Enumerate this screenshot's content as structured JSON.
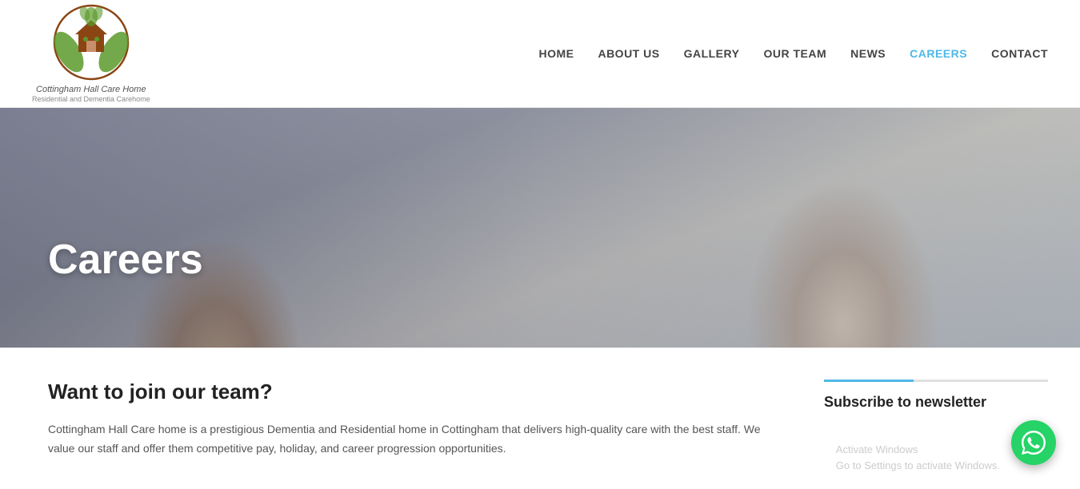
{
  "header": {
    "logo_main": "Cottingham Hall Care Home",
    "logo_sub": "Residential and Dementia Carehome",
    "nav": [
      {
        "label": "HOME",
        "active": false,
        "id": "home"
      },
      {
        "label": "ABOUT US",
        "active": false,
        "id": "about-us"
      },
      {
        "label": "GALLERY",
        "active": false,
        "id": "gallery"
      },
      {
        "label": "OUR TEAM",
        "active": false,
        "id": "our-team"
      },
      {
        "label": "NEWS",
        "active": false,
        "id": "news"
      },
      {
        "label": "CAREERS",
        "active": true,
        "id": "careers"
      },
      {
        "label": "CONTACT",
        "active": false,
        "id": "contact"
      }
    ]
  },
  "hero": {
    "title": "Careers"
  },
  "main_content": {
    "heading": "Want to join our team?",
    "body": "Cottingham Hall Care home is a prestigious Dementia and Residential home in Cottingham that delivers high-quality care with the best staff. We value our staff and offer them competitive pay, holiday, and career progression opportunities."
  },
  "sidebar": {
    "divider_color": "#4db8e8",
    "subscribe_heading": "Subscribe to newsletter"
  },
  "whatsapp": {
    "aria": "WhatsApp contact button"
  },
  "windows_watermark": {
    "line1": "Activate Windows",
    "line2": "Go to Settings to activate Windows."
  },
  "accent_color": "#4db8e8",
  "nav_active_color": "#4db8e8"
}
